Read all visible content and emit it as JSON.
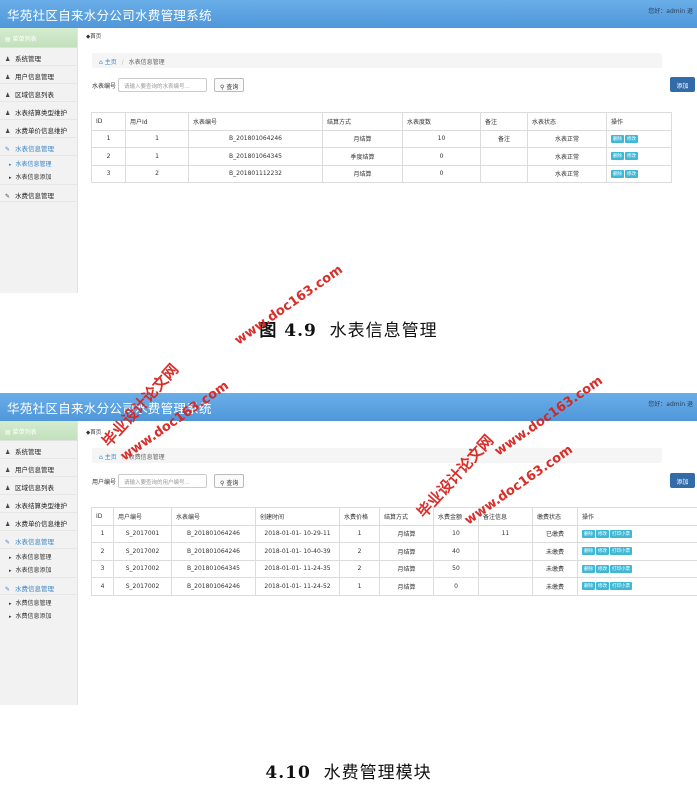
{
  "screens": [
    {
      "app_title": "华苑社区自来水分公司水费管理系统",
      "welcome": "您好：admin 退",
      "sidebar_header": "菜单列表",
      "sidebar_items": [
        "系统管理",
        "用户信息管理",
        "区域信息列表",
        "水表结算类型维护",
        "水费单价信息维护",
        "水表信息管理",
        "水费信息管理"
      ],
      "sidebar_subitems": [
        "水表信息管理",
        "水表信息添加"
      ],
      "home_tab": "首页",
      "breadcrumb": {
        "home": "主页",
        "current": "水表信息管理"
      },
      "search": {
        "label": "水表编号",
        "placeholder": "请输入要查询的水表编号...",
        "button": "查询"
      },
      "add_button": "添加",
      "columns": [
        "ID",
        "用户Id",
        "水表编号",
        "结算方式",
        "水表度数",
        "备注",
        "水表状态",
        "操作"
      ],
      "rows": [
        [
          "1",
          "1",
          "B_201801064246",
          "月结算",
          "10",
          "备注",
          "水表正常"
        ],
        [
          "2",
          "1",
          "B_201801064345",
          "季度结算",
          "0",
          "",
          "水表正常"
        ],
        [
          "3",
          "2",
          "B_201801112232",
          "月结算",
          "0",
          "",
          "水表正常"
        ]
      ],
      "row_actions": [
        "删除",
        "修改"
      ]
    },
    {
      "app_title": "华苑社区自来水分公司水费管理系统",
      "welcome": "您好：admin 退",
      "sidebar_header": "菜单列表",
      "sidebar_items": [
        "系统管理",
        "用户信息管理",
        "区域信息列表",
        "水表结算类型维护",
        "水费单价信息维护",
        "水表信息管理",
        "水费信息管理"
      ],
      "sidebar_subitems_a": [
        "水表信息管理",
        "水表信息添加"
      ],
      "sidebar_subitems_b": [
        "水费信息管理",
        "水费信息添加"
      ],
      "home_tab": "首页",
      "breadcrumb": {
        "home": "主页",
        "current": "收费信息管理"
      },
      "search": {
        "label": "用户编号",
        "placeholder": "请输入要查询的用户编号...",
        "button": "查询"
      },
      "add_button": "添加",
      "columns": [
        "ID",
        "用户编号",
        "水表编号",
        "创建时间",
        "水费价格",
        "结算方式",
        "水费金额",
        "备注信息",
        "缴费状态",
        "操作"
      ],
      "rows": [
        [
          "1",
          "S_2017001",
          "B_201801064246",
          "2018-01-01- 10-29-11",
          "1",
          "月结算",
          "10",
          "11",
          "已缴费"
        ],
        [
          "2",
          "S_2017002",
          "B_201801064246",
          "2018-01-01- 10-40-39",
          "2",
          "月结算",
          "40",
          "",
          "未缴费"
        ],
        [
          "3",
          "S_2017002",
          "B_201801064345",
          "2018-01-01- 11-24-35",
          "2",
          "月结算",
          "50",
          "",
          "未缴费"
        ],
        [
          "4",
          "S_2017002",
          "B_201801064246",
          "2018-01-01- 11-24-52",
          "1",
          "月结算",
          "0",
          "",
          "未缴费"
        ]
      ],
      "row_actions": [
        "删除",
        "修改",
        "打印小票"
      ]
    }
  ],
  "captions": {
    "fig_num": "图 4.9",
    "fig_title": "水表信息管理",
    "section_num": "4.10",
    "section_title": "水费管理模块"
  },
  "watermarks": [
    "www.doc163.com",
    "毕业设计论文网"
  ],
  "colors": {
    "topbar": "#5aa2e0",
    "accent": "#3a86c8",
    "add_button": "#326ca8",
    "mini_button": "#3fb8d6",
    "watermark": "#d8231f"
  }
}
